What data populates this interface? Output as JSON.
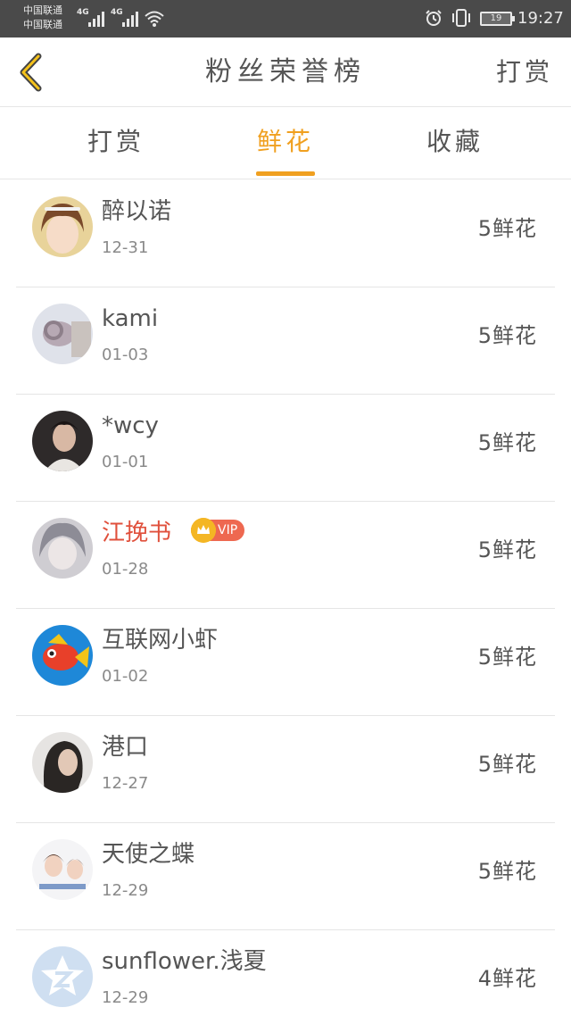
{
  "status_bar": {
    "carrier_1": "中国联通",
    "carrier_2": "中国联通",
    "network_1": "4G",
    "network_2": "4G",
    "battery": "19",
    "time": "19:27"
  },
  "header": {
    "title": "粉丝荣誉榜",
    "action": "打赏"
  },
  "tabs": [
    {
      "label": "打赏"
    },
    {
      "label": "鲜花",
      "active": true
    },
    {
      "label": "收藏"
    }
  ],
  "colors": {
    "accent": "#f0a020",
    "vip_name": "#e0503c"
  },
  "fans": [
    {
      "name": "醉以诺",
      "date": "12-31",
      "count": "5鲜花"
    },
    {
      "name": "kami",
      "date": "01-03",
      "count": "5鲜花"
    },
    {
      "name": "*wcy",
      "date": "01-01",
      "count": "5鲜花"
    },
    {
      "name": "江挽书",
      "date": "01-28",
      "count": "5鲜花",
      "badge": "VIP"
    },
    {
      "name": "互联网小虾",
      "date": "01-02",
      "count": "5鲜花"
    },
    {
      "name": "港口",
      "date": "12-27",
      "count": "5鲜花"
    },
    {
      "name": "天使之蝶",
      "date": "12-29",
      "count": "5鲜花"
    },
    {
      "name": "sunflower.浅夏",
      "date": "12-29",
      "count": "4鲜花"
    }
  ]
}
